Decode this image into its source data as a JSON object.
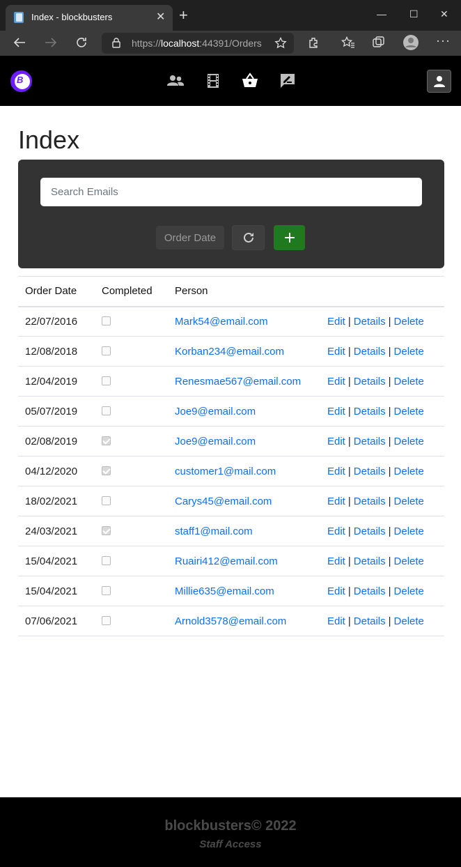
{
  "browser": {
    "tab_title": "Index - blockbusters",
    "url_prefix": "https://",
    "url_host": "localhost",
    "url_rest": ":44391/Orders"
  },
  "site": {
    "brand_letter": "B",
    "nav_items": [
      "people-icon",
      "film-icon",
      "basket-icon",
      "review-icon"
    ]
  },
  "page": {
    "title": "Index",
    "search_placeholder": "Search Emails",
    "order_date_button": "Order Date"
  },
  "table": {
    "headers": [
      "Order Date",
      "Completed",
      "Person",
      ""
    ],
    "rows": [
      {
        "date": "22/07/2016",
        "completed": false,
        "person": "Mark54@email.com"
      },
      {
        "date": "12/08/2018",
        "completed": false,
        "person": "Korban234@email.com"
      },
      {
        "date": "12/04/2019",
        "completed": false,
        "person": "Renesmae567@email.com"
      },
      {
        "date": "05/07/2019",
        "completed": false,
        "person": "Joe9@email.com"
      },
      {
        "date": "02/08/2019",
        "completed": true,
        "person": "Joe9@email.com"
      },
      {
        "date": "04/12/2020",
        "completed": true,
        "person": "customer1@mail.com"
      },
      {
        "date": "18/02/2021",
        "completed": false,
        "person": "Carys45@email.com"
      },
      {
        "date": "24/03/2021",
        "completed": true,
        "person": "staff1@mail.com"
      },
      {
        "date": "15/04/2021",
        "completed": false,
        "person": "Ruairi412@email.com"
      },
      {
        "date": "15/04/2021",
        "completed": false,
        "person": "Millie635@email.com"
      },
      {
        "date": "07/06/2021",
        "completed": false,
        "person": "Arnold3578@email.com"
      }
    ],
    "actions": {
      "edit": "Edit",
      "details": "Details",
      "delete": "Delete",
      "separator": "|"
    }
  },
  "footer": {
    "brand": "blockbusters© 2022",
    "staff": "Staff Access"
  },
  "colors": {
    "accent": "#6d1dff",
    "link": "#0d6efd",
    "add_button": "#1f7a1f"
  }
}
